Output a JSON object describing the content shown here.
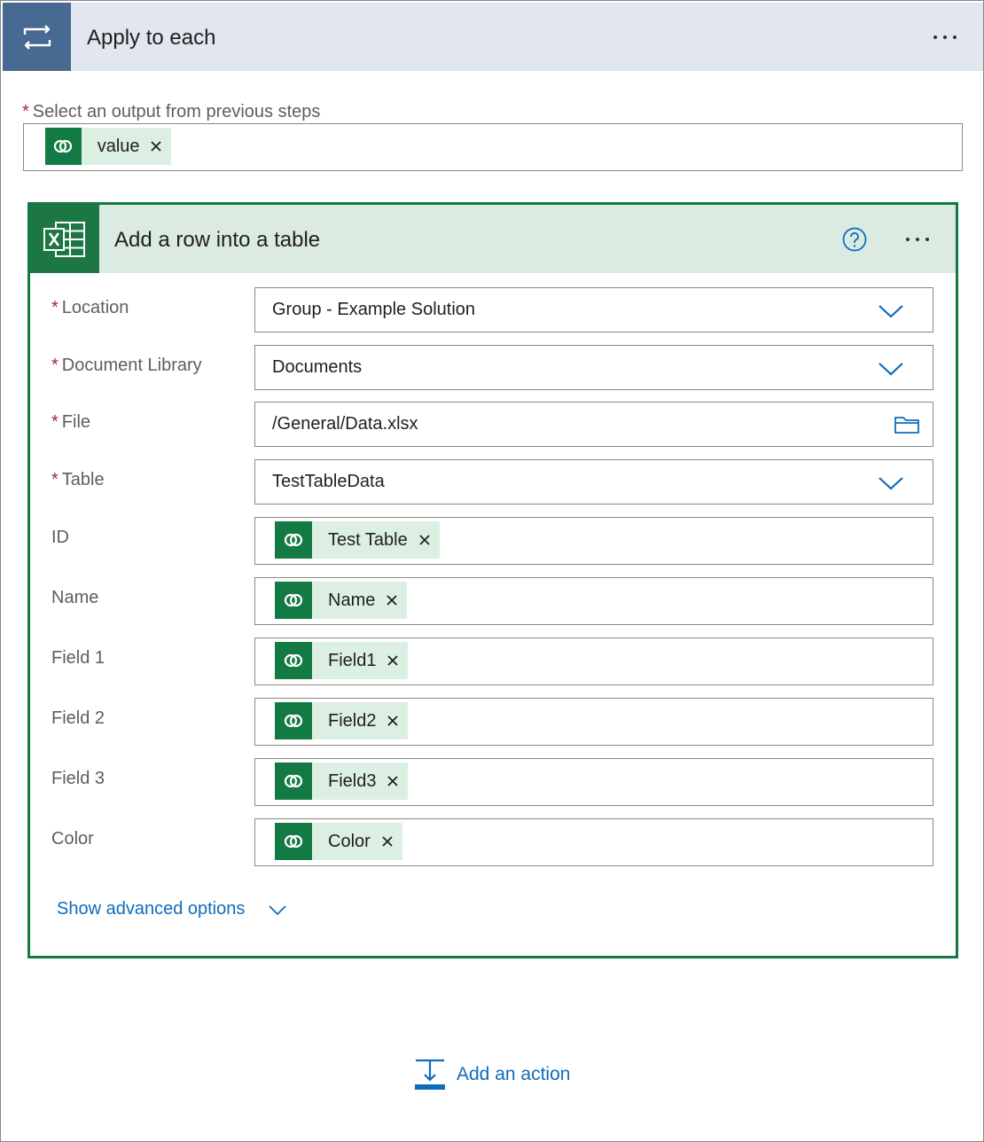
{
  "loop": {
    "title": "Apply to each",
    "select_label": "Select an output from previous steps",
    "required_marker": "*",
    "tokens": [
      {
        "label": "value"
      }
    ]
  },
  "action": {
    "title": "Add a row into a table",
    "fields": [
      {
        "label": "Location",
        "required": "*",
        "value": "Group - Example Solution",
        "control": "dropdown"
      },
      {
        "label": "Document Library",
        "required": "*",
        "value": "Documents",
        "control": "dropdown"
      },
      {
        "label": "File",
        "required": "*",
        "value": "/General/Data.xlsx",
        "control": "file-picker"
      },
      {
        "label": "Table",
        "required": "*",
        "value": "TestTableData",
        "control": "dropdown"
      },
      {
        "label": "ID",
        "token": "Test Table"
      },
      {
        "label": "Name",
        "token": "Name"
      },
      {
        "label": "Field 1",
        "token": "Field1"
      },
      {
        "label": "Field 2",
        "token": "Field2"
      },
      {
        "label": "Field 3",
        "token": "Field3"
      },
      {
        "label": "Color",
        "token": "Color"
      }
    ],
    "advanced_label": "Show advanced options"
  },
  "add_action_label": "Add an action",
  "icons": {
    "loop": "loop-icon",
    "excel": "excel-icon",
    "dataverse": "dataverse-icon",
    "help": "help-icon",
    "more": "more-options-icon",
    "chevron": "chevron-down-icon",
    "folder": "folder-icon",
    "close": "close-icon",
    "add_action": "add-action-icon"
  },
  "colors": {
    "loop_header_bg": "#e1e6ef",
    "loop_icon_bg": "#486991",
    "card_border": "#137a43",
    "card_header_bg": "#dbebe2",
    "token_bg": "#dcefe3",
    "token_icon_bg": "#137a43",
    "link": "#0f6cbd",
    "required": "#a4262c"
  }
}
